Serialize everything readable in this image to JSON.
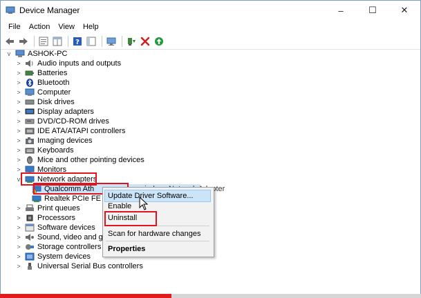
{
  "window": {
    "title": "Device Manager",
    "minimize_glyph": "–",
    "maximize_glyph": "☐",
    "close_glyph": "✕"
  },
  "menu": [
    "File",
    "Action",
    "View",
    "Help"
  ],
  "toolbar_icons": [
    "back-icon",
    "forward-icon",
    "properties-icon",
    "grid-icon",
    "help-icon",
    "panel-icon",
    "monitor-icon",
    "update-driver-icon",
    "uninstall-icon",
    "enable-icon"
  ],
  "tree": {
    "root": "ASHOK-PC",
    "categories": [
      "Audio inputs and outputs",
      "Batteries",
      "Bluetooth",
      "Computer",
      "Disk drives",
      "Display adapters",
      "DVD/CD-ROM drives",
      "IDE ATA/ATAPI controllers",
      "Imaging devices",
      "Keyboards",
      "Mice and other pointing devices",
      "Monitors",
      "Network adapters",
      "Print queues",
      "Processors",
      "Software devices",
      "Sound, video and game controllers",
      "Storage controllers",
      "System devices",
      "Universal Serial Bus controllers"
    ],
    "network_children": [
      "Qualcomm Atheros Wireless Network Adapter",
      "Realtek PCIe FE"
    ],
    "network_child_visible": [
      "Qualcomm Ath",
      "Realtek PCIe FE"
    ],
    "network_child_tail": "ireless Network Adapter"
  },
  "context_menu": {
    "items": [
      "Update Driver Software...",
      "Enable",
      "Uninstall",
      "Scan for hardware changes",
      "Properties"
    ]
  },
  "colors": {
    "highlight": "#cce4f7",
    "annotation": "#e0141e",
    "progress": "#e01c1c"
  }
}
